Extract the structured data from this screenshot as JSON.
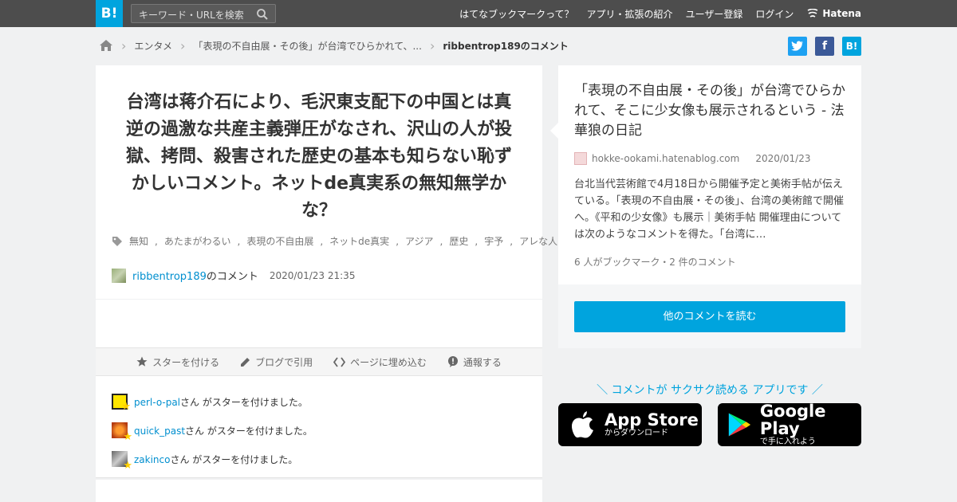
{
  "topbar": {
    "logo": "B!",
    "search_placeholder": "キーワード・URLを検索",
    "nav": [
      "はてなブックマークって？",
      "アプリ・拡張の紹介",
      "ユーザー登録",
      "ログイン"
    ],
    "hatena": "Hatena"
  },
  "breadcrumb": {
    "items": [
      "エンタメ",
      "「表現の不自由展・その後」が台湾でひらかれて、...",
      "ribbentrop189のコメント"
    ]
  },
  "share": {
    "twitter": "t",
    "facebook": "f",
    "hatebu": "B!"
  },
  "comment": {
    "text": "台湾は蒋介石により、毛沢東支配下の中国とは真逆の過激な共産主義弾圧がなされ、沢山の人が投獄、拷問、殺害された歴史の基本も知らない恥ずかしいコメント。ネットde真実系の無知無学かな？",
    "tags": [
      "無知",
      "あたまがわるい",
      "表現の不自由展",
      "ネットde真実",
      "アジア",
      "歴史",
      "宇予",
      "アレな人"
    ],
    "user": "ribbentrop189",
    "user_suffix": "のコメント",
    "timestamp": "2020/01/23 21:35"
  },
  "actions": [
    "スターを付ける",
    "ブログで引用",
    "ページに埋め込む",
    "通報する"
  ],
  "stars": {
    "suffix": "さん がスターを付けました。",
    "users": [
      "perl-o-pal",
      "quick_past",
      "zakinco"
    ]
  },
  "entry": {
    "title": "「表現の不自由展・その後」が台湾でひらかれて、そこに少女像も展示されるという - 法華狼の日記",
    "domain": "hokke-ookami.hatenablog.com",
    "date": "2020/01/23",
    "excerpt": "台北当代芸術館で4月18日から開催予定と美術手帖が伝えている。「表現の不自由展・その後」、台湾の美術館で開催へ。《平和の少女像》も展示｜美術手帖 開催理由については次のようなコメントを得た。「台湾に…",
    "stats": "6 人がブックマーク・2 件のコメント",
    "read_more": "他のコメントを読む"
  },
  "app": {
    "promo": "＼ コメントが サクサク読める アプリです ／",
    "appstore_big": "App Store",
    "appstore_small": "からダウンロード",
    "googleplay_big": "Google Play",
    "googleplay_small": "で手に入れよう"
  },
  "colors": {
    "accent": "#00a4de",
    "topbar": "#4d4d4d",
    "twitter": "#1da1f2",
    "facebook": "#3b5998"
  }
}
